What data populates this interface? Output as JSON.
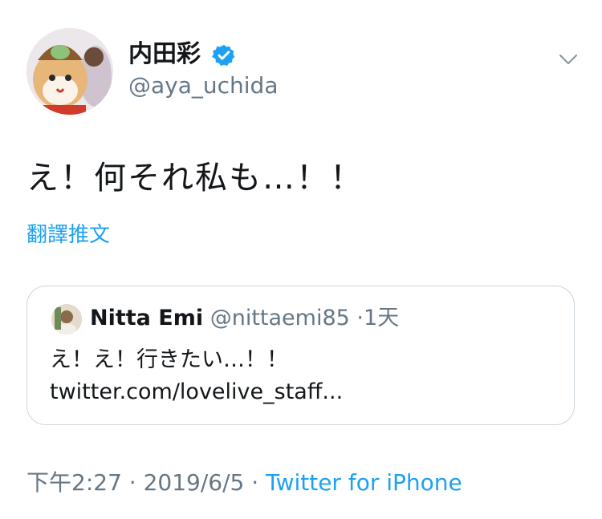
{
  "tweet": {
    "author": {
      "name": "内田彩",
      "handle": "@aya_uchida",
      "verified": true
    },
    "text": "え！何それ私も…！！",
    "translate_label": "翻譯推文",
    "quoted": {
      "name": "Nitta Emi",
      "handle": "@nittaemi85",
      "separator": "·",
      "time": "1天",
      "text": "え！え！行きたい…！！ twitter.com/lovelive_staff..."
    },
    "footer": {
      "time": "下午2:27",
      "sep1": "·",
      "date": "2019/6/5",
      "sep2": "·",
      "source": "Twitter for iPhone"
    }
  },
  "colors": {
    "accent": "#1da1f2",
    "secondary_text": "#657786",
    "primary_text": "#14171a",
    "border": "#ccd6dd"
  },
  "icons": [
    "verified-badge-icon",
    "chevron-down-icon"
  ]
}
